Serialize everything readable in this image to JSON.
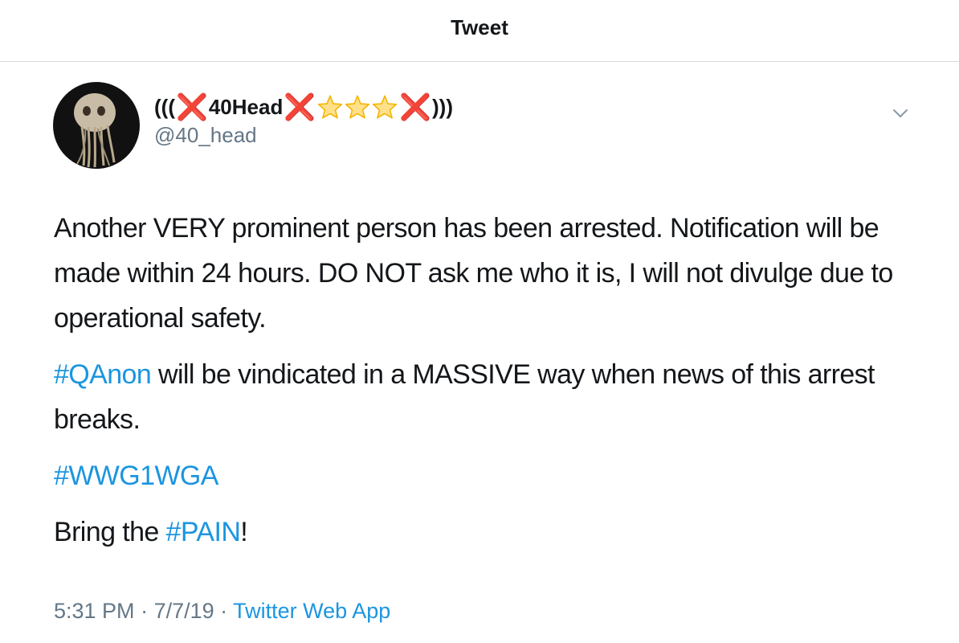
{
  "header": {
    "title": "Tweet"
  },
  "author": {
    "name_prefix": "(((",
    "x_mark": "❌",
    "name_core": "40Head",
    "name_suffix": ")))",
    "handle": "@40_head"
  },
  "tweet": {
    "p1": "Another VERY prominent person has been arrested. Notification will be made within 24 hours. DO NOT ask me who it is, I will not divulge due to operational safety.",
    "hashtag_qanon": "#QAnon",
    "p2_rest": " will be vindicated in a MASSIVE way when news of this arrest breaks.",
    "hashtag_wwg": "#WWG1WGA",
    "p4_start": "Bring the ",
    "hashtag_pain": "#PAIN",
    "p4_end": "!"
  },
  "meta": {
    "time": "5:31 PM",
    "sep1": " · ",
    "date": "7/7/19",
    "sep2": " · ",
    "source": "Twitter Web App"
  },
  "colors": {
    "link": "#1b95e0",
    "secondary_text": "#657786",
    "x_mark": "#dd2e44",
    "star": "#ffd983"
  },
  "icons": {
    "star_count": 3,
    "chevron": "chevron-down-icon"
  }
}
